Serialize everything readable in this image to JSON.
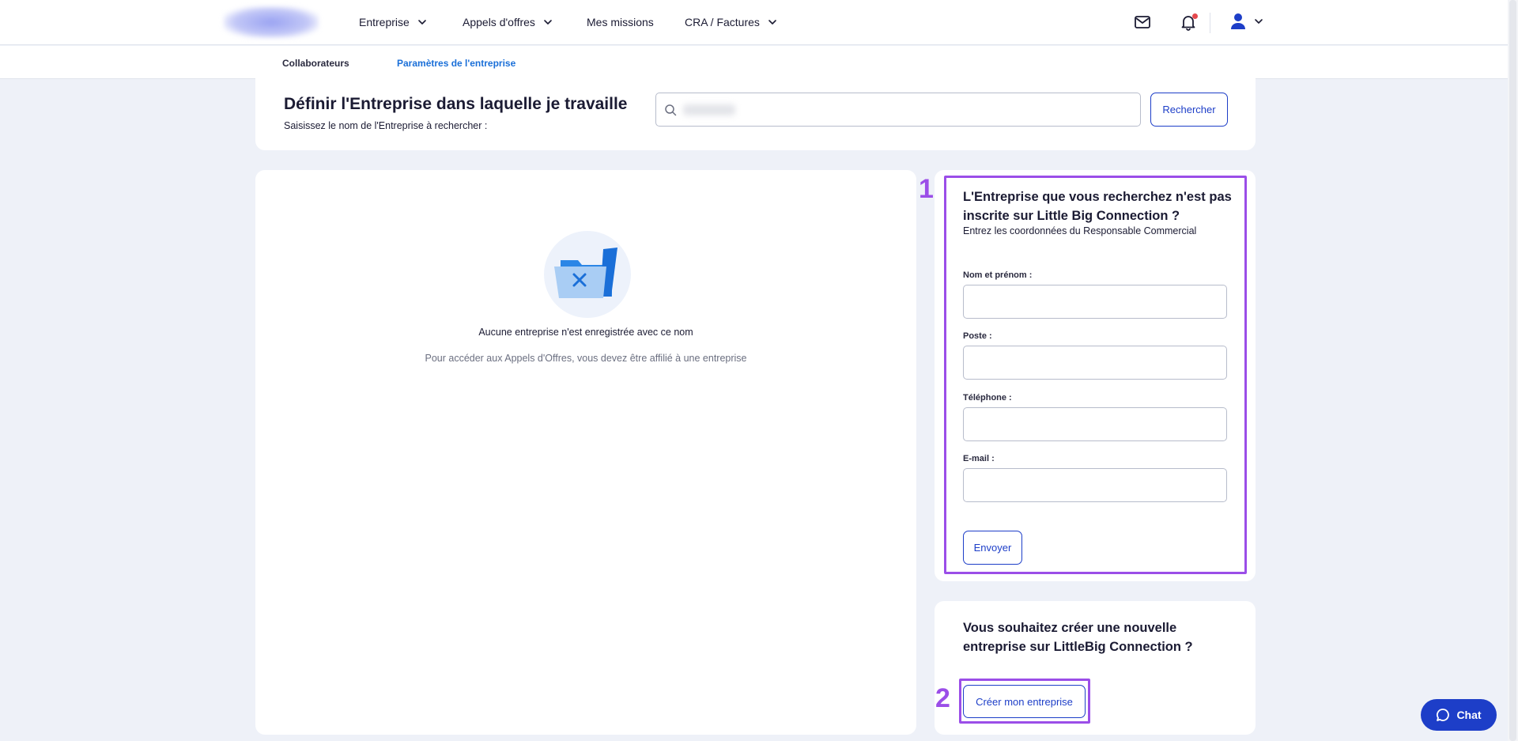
{
  "nav": {
    "items": [
      {
        "label": "Entreprise",
        "has_dropdown": true
      },
      {
        "label": "Appels d'offres",
        "has_dropdown": true
      },
      {
        "label": "Mes missions",
        "has_dropdown": false
      },
      {
        "label": "CRA / Factures",
        "has_dropdown": true
      }
    ],
    "icons": [
      "mail-icon",
      "bell-icon",
      "user-icon",
      "chevron-down-icon"
    ]
  },
  "subnav": {
    "tabs": [
      {
        "label": "Collaborateurs",
        "active": false
      },
      {
        "label": "Paramètres de l'entreprise",
        "active": true
      }
    ]
  },
  "search": {
    "title": "Définir l'Entreprise dans laquelle je travaille",
    "subtitle": "Saisissez le nom de l'Entreprise à rechercher :",
    "value": "",
    "button_label": "Rechercher"
  },
  "empty_state": {
    "title": "Aucune entreprise n'est enregistrée avec ce nom",
    "subtitle": "Pour accéder aux Appels d'Offres, vous devez être affilié à une entreprise"
  },
  "contact_form": {
    "annotation": "1",
    "title": "L'Entreprise que vous recherchez n'est pas inscrite sur Little Big Connection ?",
    "subtitle": "Entrez les coordonnées du Responsable Commercial",
    "fields": [
      {
        "label": "Nom et prénom :",
        "value": ""
      },
      {
        "label": "Poste :",
        "value": ""
      },
      {
        "label": "Téléphone :",
        "value": ""
      },
      {
        "label": "E-mail :",
        "value": ""
      }
    ],
    "submit_label": "Envoyer"
  },
  "create_company": {
    "annotation": "2",
    "title": "Vous souhaitez créer une nouvelle entreprise sur LittleBig Connection ?",
    "button_label": "Créer mon entreprise"
  },
  "chat": {
    "label": "Chat"
  },
  "colors": {
    "accent": "#1a6fd8",
    "button_blue": "#1d3ec8",
    "annotation_purple": "#9b4ee8",
    "background": "#eef1f8",
    "notification": "#e5484d"
  }
}
